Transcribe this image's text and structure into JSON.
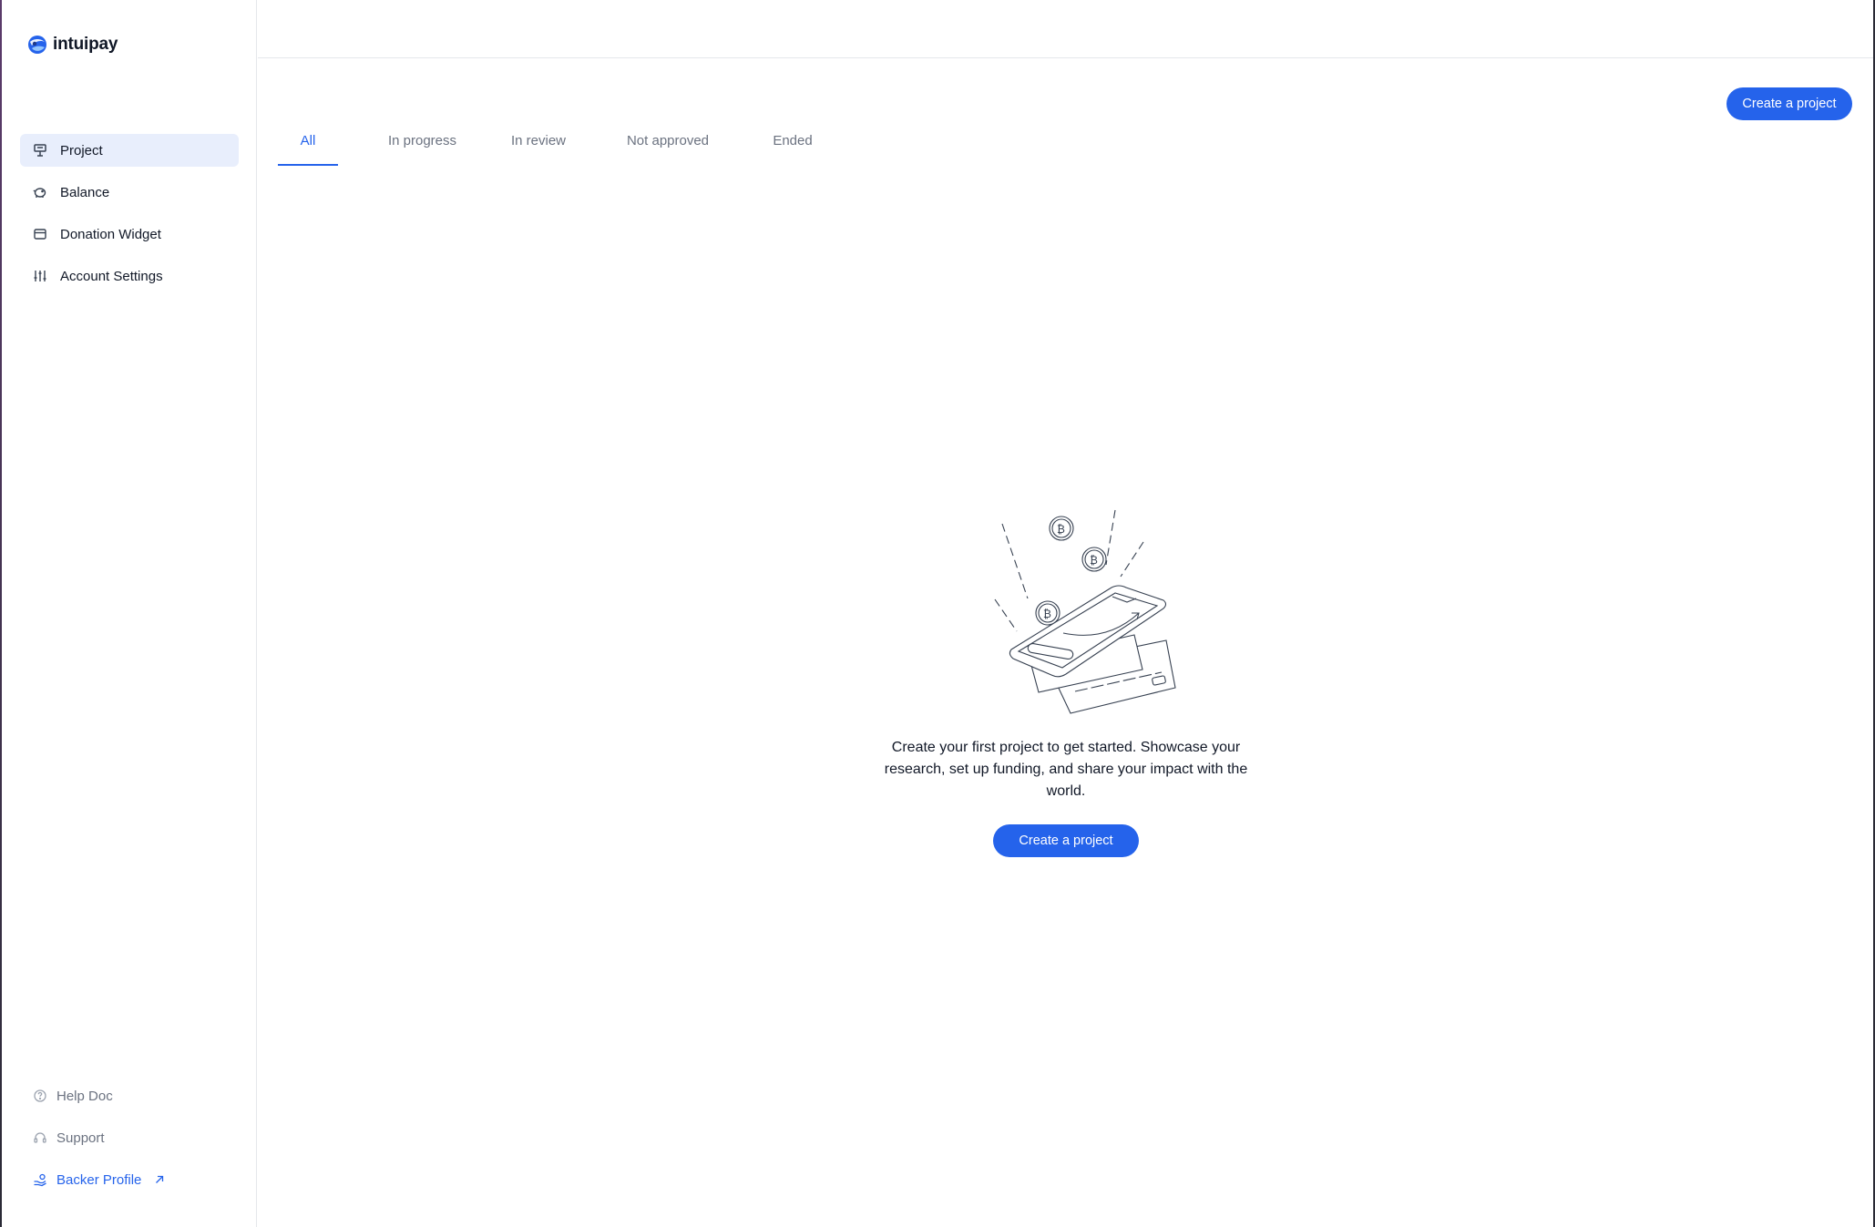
{
  "brand": {
    "name": "intuipay",
    "accent": "#2563eb"
  },
  "sidebar": {
    "items": [
      {
        "label": "Project",
        "icon": "presentation-board-icon",
        "active": true
      },
      {
        "label": "Balance",
        "icon": "piggy-bank-icon",
        "active": false
      },
      {
        "label": "Donation Widget",
        "icon": "window-icon",
        "active": false
      },
      {
        "label": "Account Settings",
        "icon": "sliders-icon",
        "active": false
      }
    ],
    "bottom": [
      {
        "label": "Help Doc",
        "icon": "help-circle-icon"
      },
      {
        "label": "Support",
        "icon": "headset-icon"
      },
      {
        "label": "Backer Profile",
        "icon": "hand-coins-icon",
        "external": true
      }
    ]
  },
  "header": {
    "create_label": "Create a project"
  },
  "tabs": [
    {
      "label": "All",
      "active": true
    },
    {
      "label": "In progress",
      "active": false
    },
    {
      "label": "In review",
      "active": false
    },
    {
      "label": "Not approved",
      "active": false
    },
    {
      "label": "Ended",
      "active": false
    }
  ],
  "empty_state": {
    "message": "Create your first project to get started. Showcase your research, set up funding, and share your impact with the world.",
    "button_label": "Create a project"
  }
}
